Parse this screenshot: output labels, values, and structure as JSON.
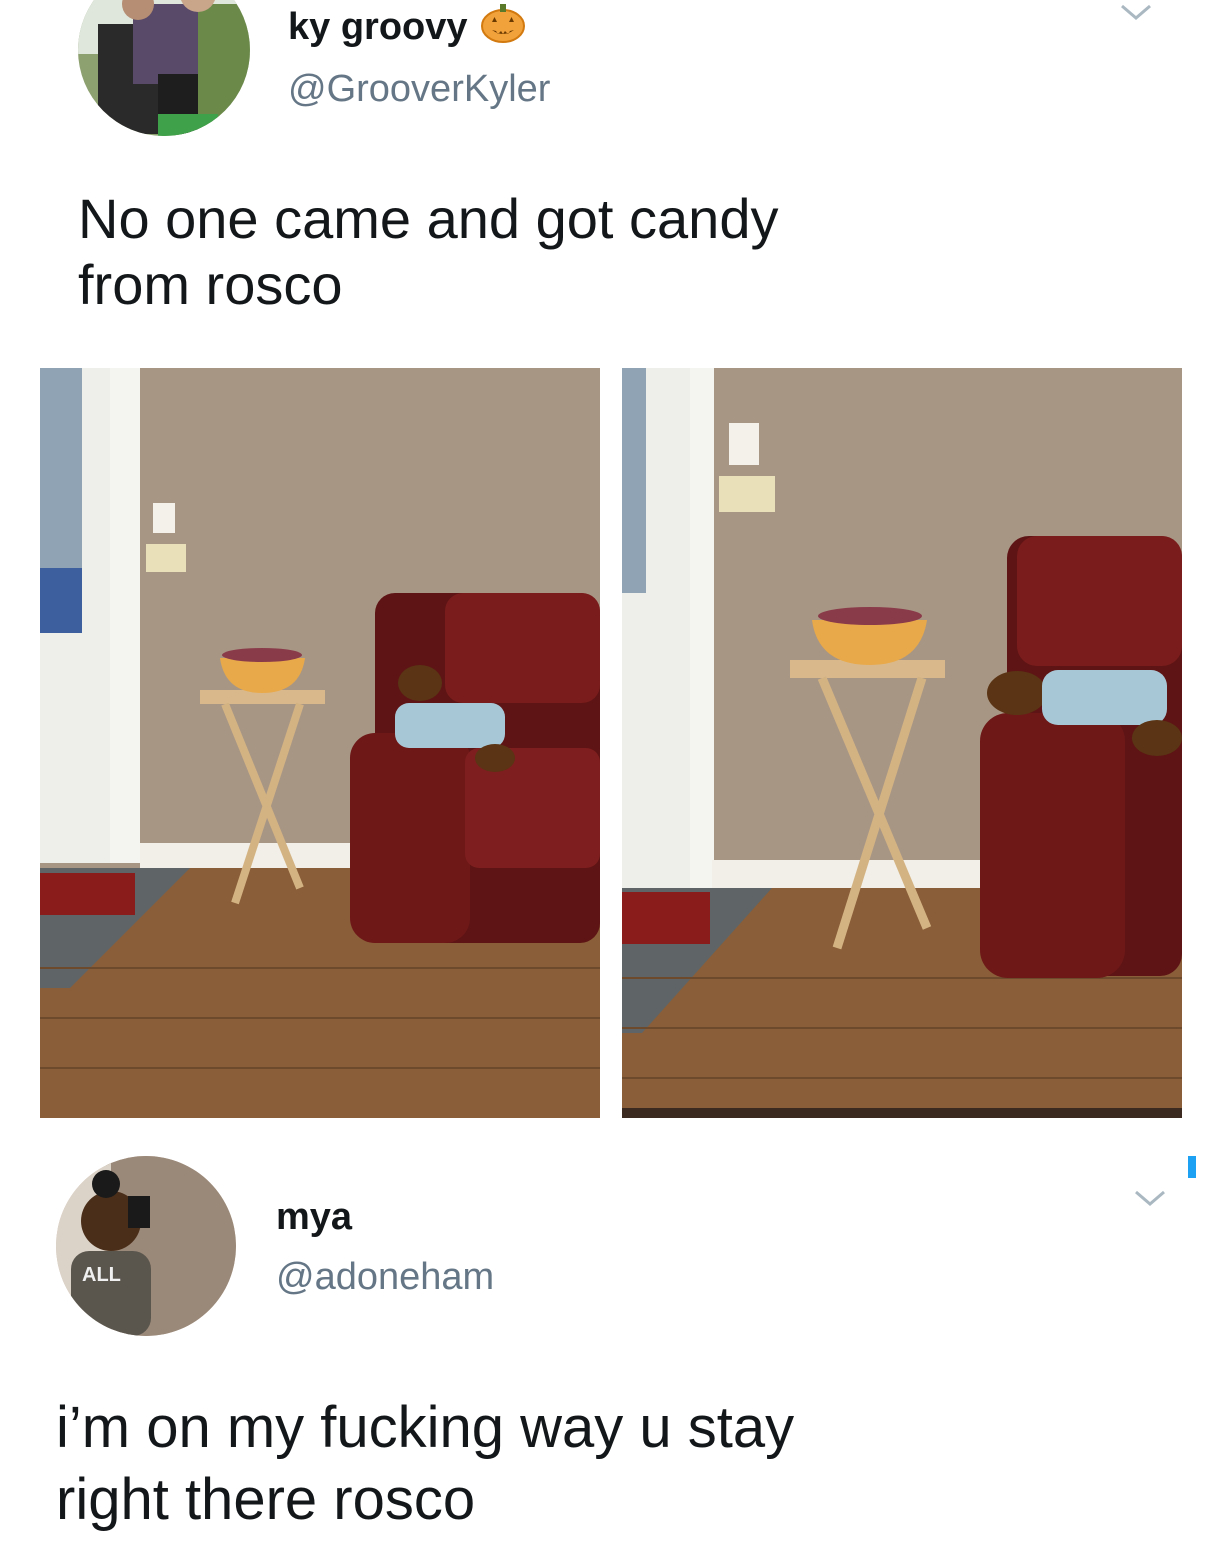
{
  "tweets": [
    {
      "display_name": "ky groovy",
      "name_emoji": "jack-o-lantern-icon",
      "handle": "@GrooverKyler",
      "text_line1": "No one came and got candy",
      "text_line2": "from rosco",
      "media_count": 2
    },
    {
      "display_name": "mya",
      "handle": "@adoneham",
      "text_line1": "i’m on my fucking way u stay",
      "text_line2": "right there rosco"
    }
  ],
  "colors": {
    "text_primary": "#14171a",
    "text_secondary": "#657786",
    "chevron": "#aab8c2",
    "accent": "#1da1f2"
  }
}
